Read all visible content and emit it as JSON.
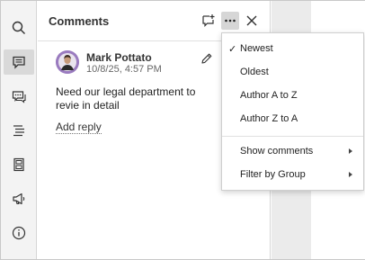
{
  "panel": {
    "title": "Comments"
  },
  "comment": {
    "author": "Mark Pottato",
    "timestamp": "10/8/25, 4:57 PM",
    "text": "Need our legal department to revie in detail",
    "add_reply": "Add reply"
  },
  "menu": {
    "items": [
      {
        "label": "Newest",
        "checked": true,
        "submenu": false
      },
      {
        "label": "Oldest",
        "checked": false,
        "submenu": false
      },
      {
        "label": "Author A to Z",
        "checked": false,
        "submenu": false
      },
      {
        "label": "Author Z to A",
        "checked": false,
        "submenu": false
      },
      {
        "label": "Show comments",
        "checked": false,
        "submenu": true
      },
      {
        "label": "Filter by Group",
        "checked": false,
        "submenu": true
      }
    ],
    "check_glyph": "✓"
  },
  "rail": {
    "icons": [
      "search-icon",
      "comment-icon",
      "chat-icon",
      "headings-icon",
      "page-thumbnails-icon",
      "megaphone-icon",
      "info-icon"
    ],
    "active": "comment-icon"
  },
  "colors": {
    "rail_bg": "#f3f3f3",
    "active_bg": "#d9d9d9",
    "avatar_bg": "#9a7bbf"
  }
}
